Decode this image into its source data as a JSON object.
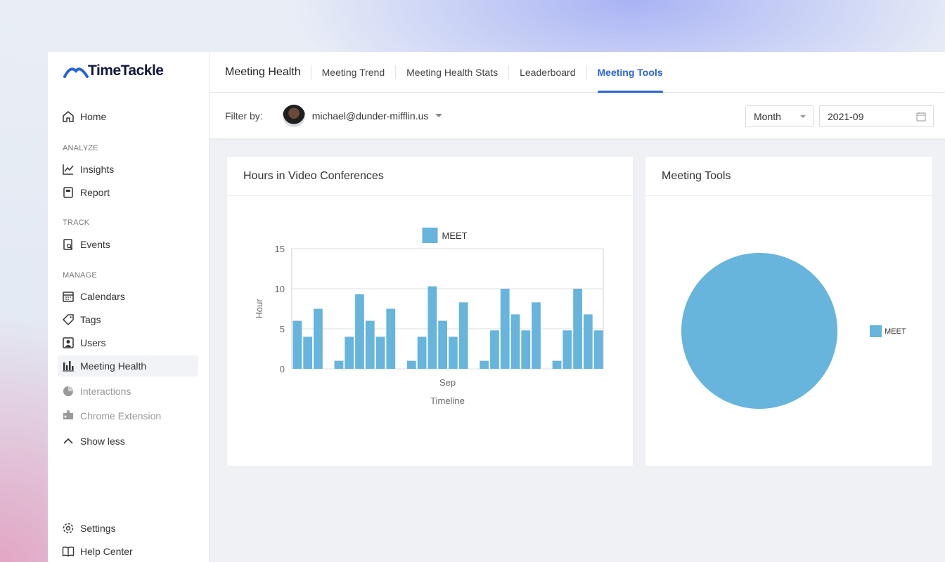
{
  "app": {
    "logo_text": "TimeTackle"
  },
  "sidebar": {
    "home": "Home",
    "analyze_label": "ANALYZE",
    "insights": "Insights",
    "report": "Report",
    "track_label": "TRACK",
    "events": "Events",
    "manage_label": "MANAGE",
    "calendars": "Calendars",
    "tags": "Tags",
    "users": "Users",
    "meeting_health": "Meeting Health",
    "interactions": "Interactions",
    "chrome_extension": "Chrome Extension",
    "show_less": "Show less",
    "settings": "Settings",
    "help_center": "Help Center"
  },
  "header": {
    "title": "Meeting Health",
    "tabs": [
      "Meeting Trend",
      "Meeting Health Stats",
      "Leaderboard",
      "Meeting Tools"
    ],
    "active_tab": "Meeting Tools"
  },
  "filter": {
    "label": "Filter by:",
    "user": "michael@dunder-mifflin.us",
    "period": "Month",
    "date": "2021-09"
  },
  "cards": {
    "video_title": "Hours in Video Conferences",
    "tools_title": "Meeting Tools"
  },
  "colors": {
    "accent": "#2a62d8",
    "series": "#67b4dc"
  },
  "chart_data": [
    {
      "type": "bar",
      "title": "Hours in Video Conferences",
      "xlabel": "Timeline",
      "ylabel": "Hour",
      "x_tick_label": "Sep",
      "ylim": [
        0,
        15
      ],
      "yticks": [
        0,
        5,
        10,
        15
      ],
      "legend": "top",
      "series": [
        {
          "name": "MEET",
          "values": [
            6,
            4,
            7.5,
            0,
            1,
            4,
            9.3,
            6,
            4,
            7.5,
            0,
            1,
            4,
            10.3,
            6,
            4,
            8.3,
            0,
            1,
            4.8,
            10,
            6.8,
            4.8,
            8.3,
            0,
            1,
            4.8,
            10,
            6.8,
            4.8
          ]
        }
      ]
    },
    {
      "type": "pie",
      "title": "Meeting Tools",
      "legend": "right",
      "series": [
        {
          "name": "MEET",
          "values": [
            100
          ]
        }
      ]
    }
  ]
}
